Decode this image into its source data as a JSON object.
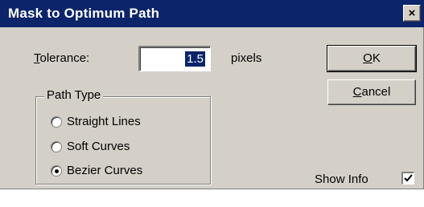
{
  "window": {
    "title": "Mask to Optimum Path",
    "close_glyph": "×"
  },
  "tolerance": {
    "label": "Tolerance:",
    "value": "1.5",
    "unit": "pixels"
  },
  "buttons": {
    "ok": "OK",
    "cancel": "Cancel"
  },
  "path_type": {
    "legend": "Path Type",
    "options": [
      {
        "label": "Straight Lines",
        "selected": false
      },
      {
        "label": "Soft Curves",
        "selected": false
      },
      {
        "label": "Bezier Curves",
        "selected": true
      }
    ]
  },
  "show_info": {
    "label": "Show Info",
    "checked": true
  },
  "colors": {
    "titlebar": "#0b246a",
    "dialog_face": "#d4d0c8",
    "selection": "#0b246a"
  }
}
